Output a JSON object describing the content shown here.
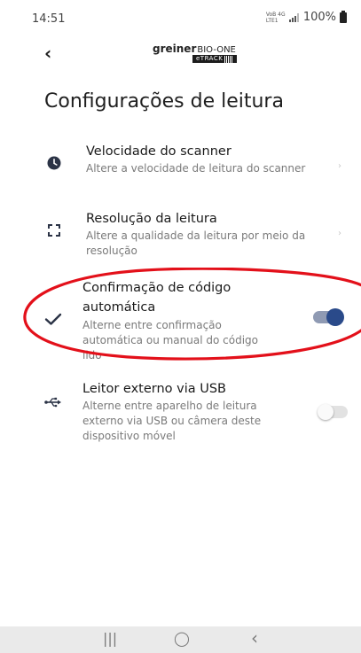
{
  "status_bar": {
    "time": "14:51",
    "network": "VoB 4G LTE1",
    "battery": "100%"
  },
  "header": {
    "back": "‹",
    "brand": "greiner",
    "brand_suffix": "BIO-ONE",
    "product": "eTRACK"
  },
  "page": {
    "title": "Configurações de leitura"
  },
  "settings": [
    {
      "title": "Velocidade do scanner",
      "description": "Altere a velocidade de leitura do scanner",
      "icon": "clock-icon",
      "control": "chevron",
      "chevron": "›"
    },
    {
      "title": "Resolução da leitura",
      "description": "Altere a qualidade da leitura por meio da resolução",
      "icon": "resolution-icon",
      "control": "chevron",
      "chevron": "›"
    },
    {
      "title": "Confirmação de código automática",
      "description": "Alterne entre confirmação automática ou manual do código lido",
      "icon": "checkmark-icon",
      "control": "toggle",
      "enabled": true
    },
    {
      "title": "Leitor externo via USB",
      "description": "Alterne entre aparelho de leitura externo via USB ou câmera deste dispositivo móvel",
      "icon": "usb-icon",
      "control": "toggle",
      "enabled": false
    }
  ],
  "annotation": {
    "color": "#e3101a",
    "shape": "ellipse"
  },
  "colors": {
    "accent": "#2a4a8a",
    "toggle_track_on": "#8f9ab3",
    "toggle_track_off": "#e2e2e2"
  },
  "navbar": {
    "recents": "|||",
    "home": "◯",
    "back": "‹"
  }
}
